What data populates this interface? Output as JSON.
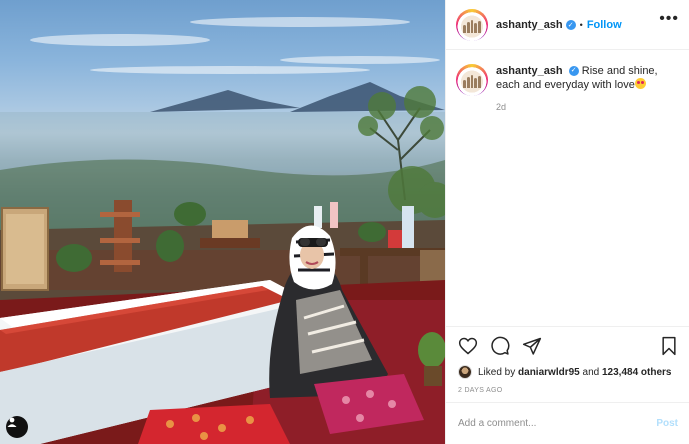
{
  "post": {
    "username": "ashanty_ash",
    "verified": true,
    "follow_label": "Follow",
    "dot": "•",
    "more_label": "•••",
    "caption": {
      "username": "ashanty_ash",
      "text": "Rise and shine, each and everyday with love",
      "emoji": "heart-eyes-emoji",
      "age": "2d"
    },
    "likes": {
      "prefix": "Liked by",
      "user": "daniarwldr95",
      "middle": "and",
      "count": "123,484 others"
    },
    "date": "2 DAYS AGO",
    "comment": {
      "placeholder": "Add a comment...",
      "post_label": "Post"
    }
  },
  "colors": {
    "accent": "#0095f6",
    "verified": "#3897f0",
    "muted": "#8e8e8e",
    "post_disabled": "#b2dffc"
  }
}
